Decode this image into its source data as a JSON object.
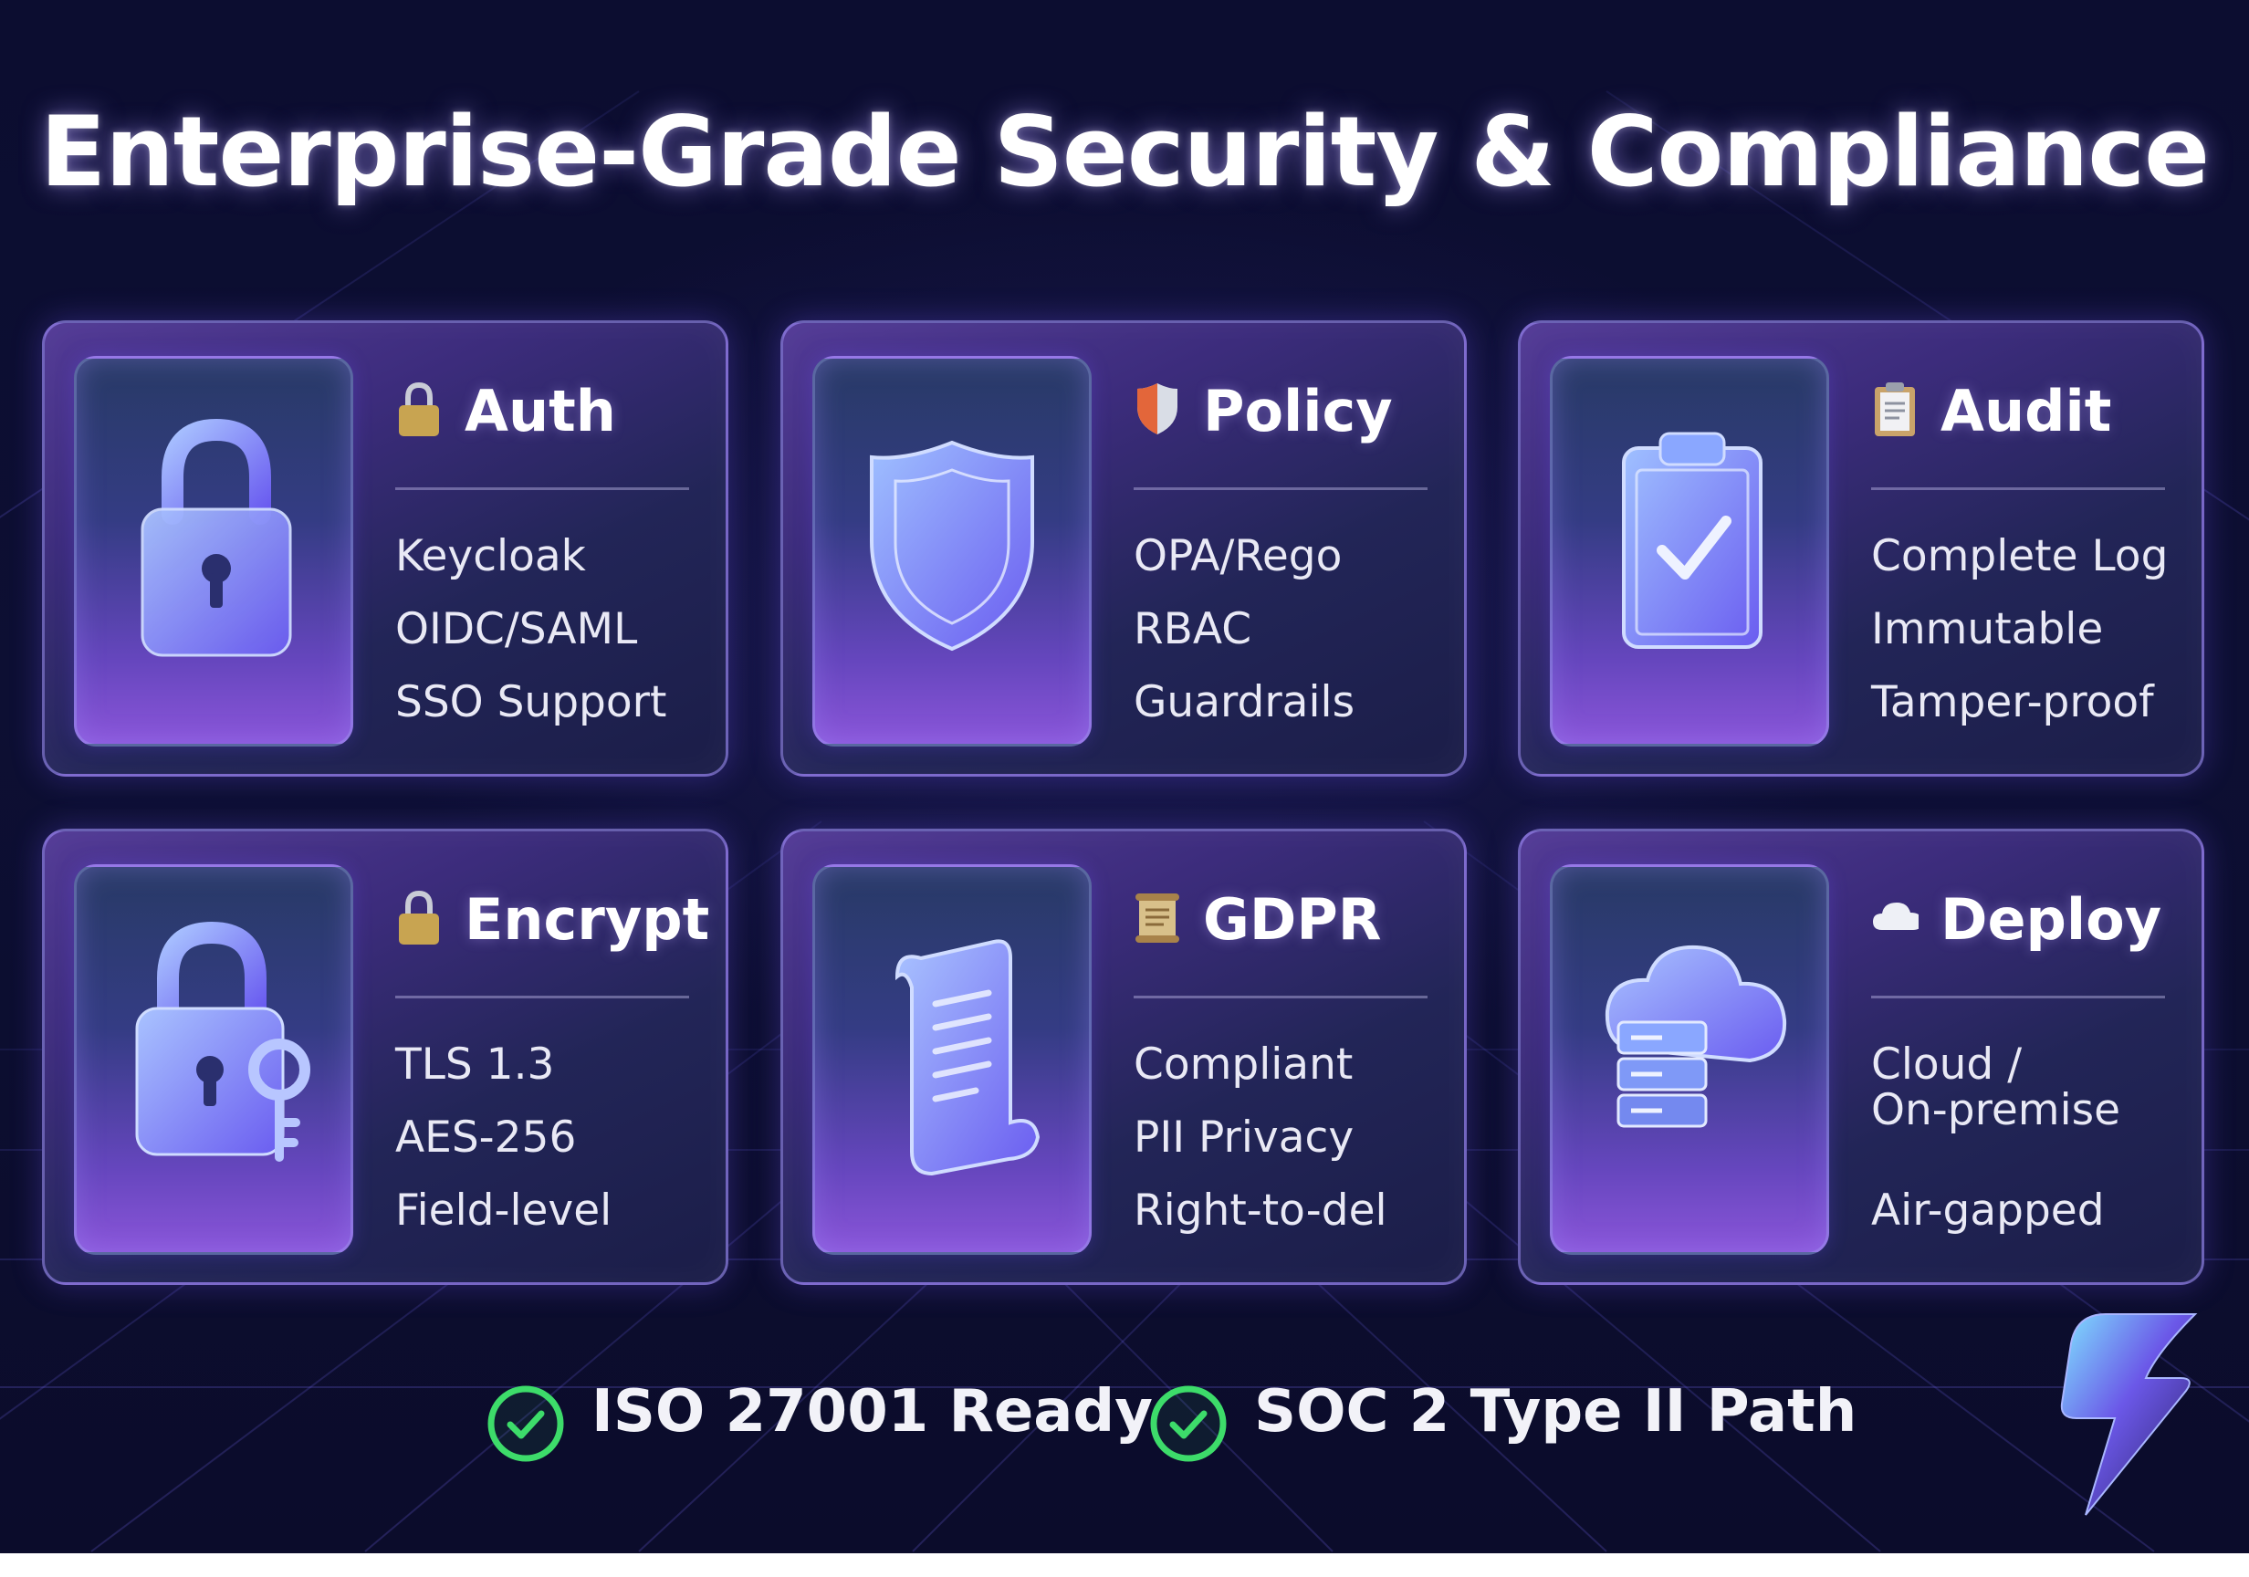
{
  "page": {
    "title": "Enterprise-Grade Security & Compliance"
  },
  "cards": [
    {
      "title": "Auth",
      "emoji": "lock-emoji",
      "icon": "padlock-icon",
      "features": [
        "Keycloak",
        "OIDC/SAML",
        "SSO Support"
      ]
    },
    {
      "title": "Policy",
      "emoji": "shield-emoji",
      "icon": "shield-icon",
      "features": [
        "OPA/Rego",
        "RBAC",
        "Guardrails"
      ]
    },
    {
      "title": "Audit",
      "emoji": "clipboard-emoji",
      "icon": "clipboard-check-icon",
      "features": [
        "Complete Log",
        "Immutable",
        "Tamper-proof"
      ]
    },
    {
      "title": "Encrypt",
      "emoji": "lock-emoji",
      "icon": "padlock-key-icon",
      "features": [
        "TLS 1.3",
        "AES-256",
        "Field-level"
      ]
    },
    {
      "title": "GDPR",
      "emoji": "scroll-emoji",
      "icon": "scroll-icon",
      "features": [
        "Compliant",
        "PII Privacy",
        "Right-to-del"
      ]
    },
    {
      "title": "Deploy",
      "emoji": "cloud-emoji",
      "icon": "cloud-server-icon",
      "features": [
        "Cloud /",
        "On-premise",
        "Air-gapped"
      ]
    }
  ],
  "badges": [
    {
      "label": "ISO 27001 Ready",
      "icon": "check-circle-icon"
    },
    {
      "label": "SOC 2 Type II Path",
      "icon": "check-circle-icon"
    }
  ],
  "brand": {
    "logo": "lightning-bolt-logo"
  },
  "colors": {
    "background": "#0c0d30",
    "card_border": "#a596ff",
    "icon_glow": "#8a7cff",
    "check_green": "#3ddc6a"
  }
}
